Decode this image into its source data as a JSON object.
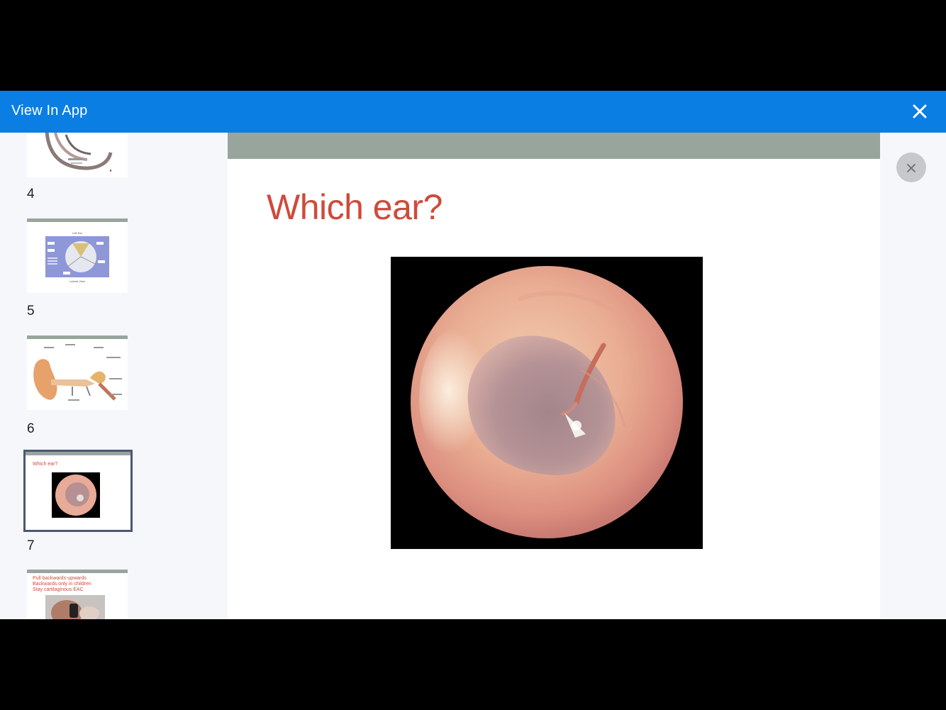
{
  "topbar": {
    "title": "View In App"
  },
  "sidebar": {
    "thumbnails": [
      {
        "number": "4"
      },
      {
        "number": "5",
        "heading": "Left Ear",
        "caption": "Lateral View"
      },
      {
        "number": "6"
      },
      {
        "number": "7",
        "title": "Which ear?",
        "selected": true
      },
      {
        "lines": [
          "Pull backwards-upwards",
          "Backwards only in children",
          "Stay cartilaginous EAC"
        ]
      }
    ]
  },
  "slide": {
    "title": "Which ear?"
  },
  "colors": {
    "accent": "#0a7ee3",
    "slide_band": "#98a59d",
    "title_red": "#cf4a3b",
    "selected_border": "#4b5775"
  }
}
